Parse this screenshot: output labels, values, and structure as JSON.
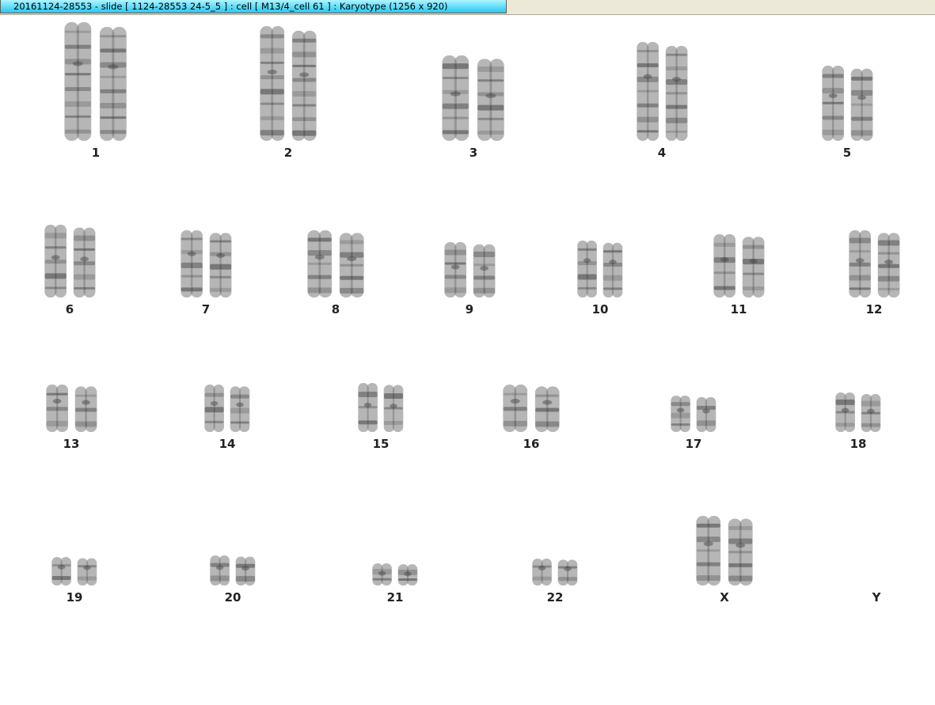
{
  "window": {
    "title": "20161124-28553 - slide [ 1124-28553 24-5_5 ] : cell [ M13/4_cell 61 ] : Karyotype  (1256 x 920)"
  },
  "colors": {
    "chromosome": "#7a7a7a",
    "band_dark": "#4a4a4a",
    "background": "#ffffff"
  },
  "chromosomes": [
    {
      "label": "1"
    },
    {
      "label": "2"
    },
    {
      "label": "3"
    },
    {
      "label": "4"
    },
    {
      "label": "5"
    },
    {
      "label": "6"
    },
    {
      "label": "7"
    },
    {
      "label": "8"
    },
    {
      "label": "9"
    },
    {
      "label": "10"
    },
    {
      "label": "11"
    },
    {
      "label": "12"
    },
    {
      "label": "13"
    },
    {
      "label": "14"
    },
    {
      "label": "15"
    },
    {
      "label": "16"
    },
    {
      "label": "17"
    },
    {
      "label": "18"
    },
    {
      "label": "19"
    },
    {
      "label": "20"
    },
    {
      "label": "21"
    },
    {
      "label": "22"
    },
    {
      "label": "X"
    },
    {
      "label": "Y"
    }
  ]
}
